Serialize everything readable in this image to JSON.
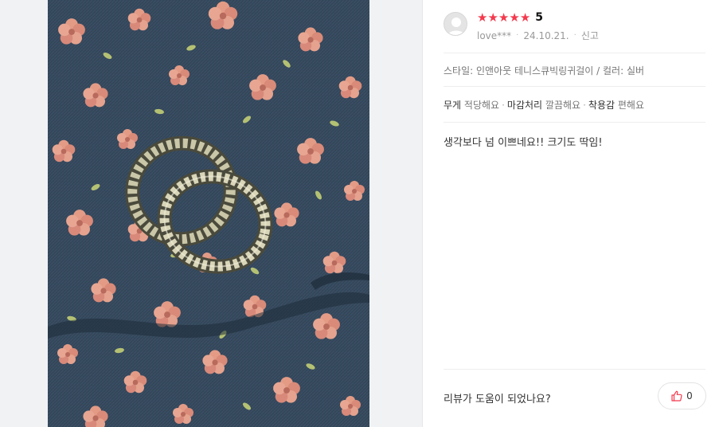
{
  "review": {
    "rating_value": "5",
    "stars": [
      "★",
      "★",
      "★",
      "★",
      "★"
    ],
    "username": "love***",
    "date": "24.10.21.",
    "report_label": "신고",
    "style_label": "스타일",
    "style_value": "인앤아웃 테니스큐빅링귀걸이",
    "color_label": "컬러",
    "color_value": "실버",
    "evaluations": [
      {
        "key": "무게",
        "value": "적당해요"
      },
      {
        "key": "마감처리",
        "value": "깔끔해요"
      },
      {
        "key": "착용감",
        "value": "편해요"
      }
    ],
    "body": "생각보다 넘 이쁘네요!! 크기도 딱임!"
  },
  "helpful": {
    "question": "리뷰가 도움이 되었나요?",
    "count": "0"
  },
  "colors": {
    "star": "#f4394d",
    "accent": "#f4394d"
  }
}
